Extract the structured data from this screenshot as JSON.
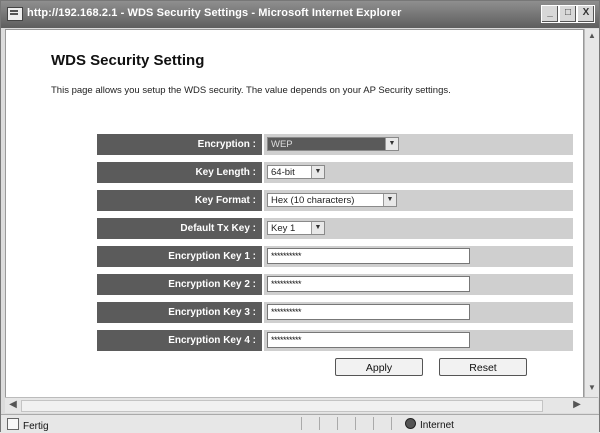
{
  "window": {
    "title": "http://192.168.2.1 - WDS Security Settings - Microsoft Internet Explorer",
    "controls": {
      "minimize": "_",
      "maximize": "□",
      "close": "X"
    }
  },
  "page": {
    "heading": "WDS Security Setting",
    "description": "This page allows you setup the WDS security. The value depends on your AP Security settings."
  },
  "form": {
    "fields": [
      {
        "label": "Encryption :",
        "type": "select",
        "value": "WEP"
      },
      {
        "label": "Key Length :",
        "type": "select",
        "value": "64-bit"
      },
      {
        "label": "Key Format :",
        "type": "select",
        "value": "Hex (10 characters)"
      },
      {
        "label": "Default Tx Key :",
        "type": "select",
        "value": "Key 1"
      },
      {
        "label": "Encryption Key 1 :",
        "type": "password",
        "value": "**********"
      },
      {
        "label": "Encryption Key 2 :",
        "type": "password",
        "value": "**********"
      },
      {
        "label": "Encryption Key 3 :",
        "type": "password",
        "value": "**********"
      },
      {
        "label": "Encryption Key 4 :",
        "type": "password",
        "value": "**********"
      }
    ],
    "apply_label": "Apply",
    "reset_label": "Reset"
  },
  "statusbar": {
    "left_text": "Fertig",
    "zone_text": "Internet"
  },
  "icons": {
    "app": "ie-page-icon",
    "dropdown": "chevron-down-icon",
    "status": "page-done-icon",
    "zone": "globe-icon"
  },
  "colors": {
    "titlebar": "#6e6e6e",
    "label_bg": "#5b5b5b",
    "value_bg": "#cfcfcf"
  }
}
